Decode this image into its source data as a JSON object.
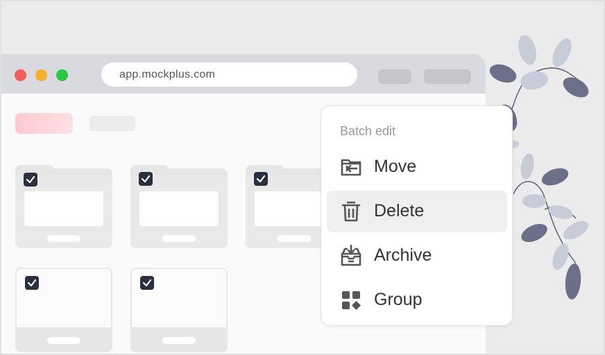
{
  "browser": {
    "url": "app.mockplus.com"
  },
  "menu": {
    "title": "Batch edit",
    "items": [
      {
        "label": "Move",
        "icon": "folder-move-icon",
        "active": false
      },
      {
        "label": "Delete",
        "icon": "trash-icon",
        "active": true
      },
      {
        "label": "Archive",
        "icon": "archive-icon",
        "active": false
      },
      {
        "label": "Group",
        "icon": "group-icon",
        "active": false
      }
    ]
  },
  "colors": {
    "accent": "#ffc9d1",
    "checkbox": "#2b3040",
    "menu_text": "#333333",
    "menu_title": "#999999"
  }
}
